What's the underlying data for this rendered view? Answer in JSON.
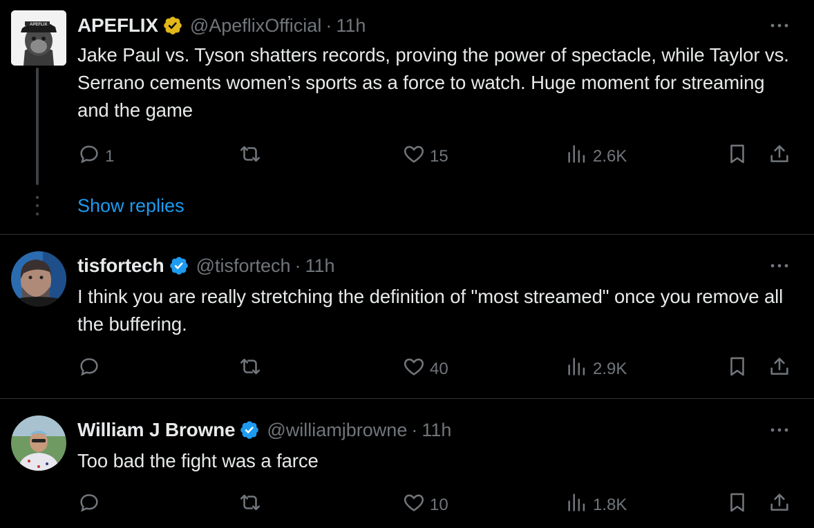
{
  "colors": {
    "background": "#000000",
    "text": "#e7e9ea",
    "muted": "#71767b",
    "link": "#1d9bf0",
    "gold_badge": "#e2b719",
    "blue_badge": "#1d9bf0",
    "divider": "#2f3336"
  },
  "tweets": [
    {
      "name": "APEFLIX",
      "badge": "gold-verified-icon",
      "handle": "@ApeflixOfficial",
      "sep": "·",
      "time": "11h",
      "text": "Jake Paul vs. Tyson shatters records, proving the power of spectacle, while Taylor vs. Serrano cements women’s sports as a force to watch. Huge moment for streaming and the game",
      "replies": "1",
      "reposts": "",
      "likes": "15",
      "views": "2.6K",
      "show_replies": "Show replies"
    },
    {
      "name": "tisfortech",
      "badge": "blue-verified-icon",
      "handle": "@tisfortech",
      "sep": "·",
      "time": "11h",
      "text": "I think you are really stretching the definition of \"most streamed\" once you remove all the buffering.",
      "replies": "",
      "reposts": "",
      "likes": "40",
      "views": "2.9K"
    },
    {
      "name": "William J Browne",
      "badge": "blue-verified-icon",
      "handle": "@williamjbrowne",
      "sep": "·",
      "time": "11h",
      "text": "Too bad the fight was a farce",
      "replies": "",
      "reposts": "",
      "likes": "10",
      "views": "1.8K"
    }
  ]
}
